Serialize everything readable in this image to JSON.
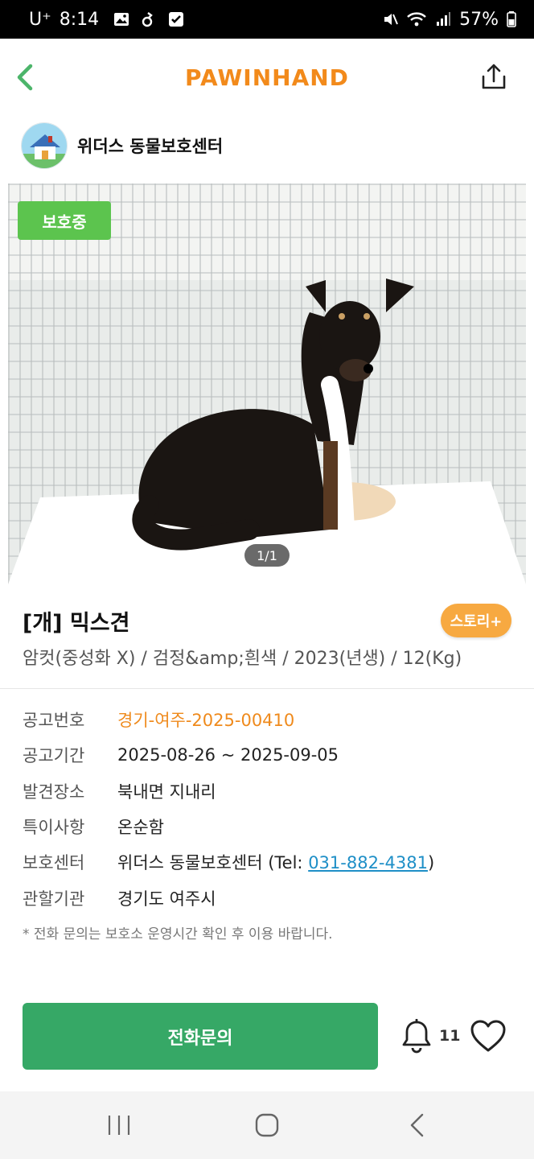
{
  "status_bar": {
    "carrier": "U⁺",
    "time": "8:14",
    "battery": "57%",
    "icons_left": [
      "image-icon",
      "notification-icon",
      "checkbox-icon"
    ],
    "icons_right": [
      "mute-icon",
      "wifi-icon",
      "signal-icon",
      "battery-icon"
    ]
  },
  "header": {
    "brand": "PAWINHAND",
    "brand_color": "#f28a1b",
    "back_icon": "chevron-left-icon",
    "share_icon": "share-icon"
  },
  "shelter": {
    "name": "위더스 동물보호센터",
    "avatar_icon": "house-avatar-icon"
  },
  "photo": {
    "status_tag": "보호중",
    "status_color": "#5cc44e",
    "counter": "1/1"
  },
  "animal": {
    "title": "[개] 믹스견",
    "story_button": "스토리+",
    "summary": "암컷(중성화 X) / 검정&amp;흰색 / 2023(년생) / 12(Kg)"
  },
  "info": [
    {
      "label": "공고번호",
      "value": "경기-여주-2025-00410"
    },
    {
      "label": "공고기간",
      "value": "2025-08-26 ~ 2025-09-05"
    },
    {
      "label": "발견장소",
      "value": "북내면 지내리"
    },
    {
      "label": "특이사항",
      "value": "온순함"
    },
    {
      "label": "보호센터",
      "value_prefix": "위더스 동물보호센터 (Tel: ",
      "phone": "031-882-4381",
      "value_suffix": ")"
    },
    {
      "label": "관할기관",
      "value": "경기도 여주시"
    }
  ],
  "notice": "* 전화 문의는 보호소 운영시간 확인 후 이용 바랍니다.",
  "actions": {
    "call_button": "전화문의",
    "call_color": "#36a866",
    "bell_count": "11"
  }
}
